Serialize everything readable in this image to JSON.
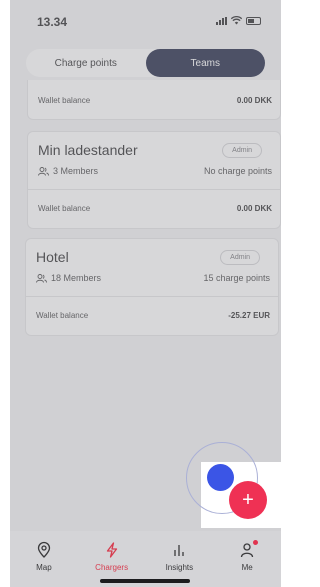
{
  "status_bar": {
    "time": "13.34"
  },
  "segment": {
    "tabs": [
      {
        "label": "Charge points"
      },
      {
        "label": "Teams"
      }
    ]
  },
  "teams": [
    {
      "title": "",
      "badge": "",
      "members": "",
      "charge_points": "",
      "wallet_label": "Wallet balance",
      "wallet_value": "0.00 DKK"
    },
    {
      "title": "Min ladestander",
      "badge": "Admin",
      "members": "3 Members",
      "charge_points": "No charge points",
      "wallet_label": "Wallet balance",
      "wallet_value": "0.00 DKK"
    },
    {
      "title": "Hotel",
      "badge": "Admin",
      "members": "18 Members",
      "charge_points": "15 charge points",
      "wallet_label": "Wallet balance",
      "wallet_value": "-25.27 EUR"
    }
  ],
  "fab": {
    "icon": "plus-icon",
    "symbol": "+",
    "color": "#ef3154"
  },
  "tabbar": {
    "items": [
      {
        "label": "Map",
        "icon": "map-pin-icon"
      },
      {
        "label": "Chargers",
        "icon": "lightning-icon"
      },
      {
        "label": "Insights",
        "icon": "bar-chart-icon"
      },
      {
        "label": "Me",
        "icon": "user-icon"
      }
    ]
  },
  "colors": {
    "accent": "#ef3154",
    "navy": "#12193a",
    "highlight_blue": "#3b55e6"
  }
}
